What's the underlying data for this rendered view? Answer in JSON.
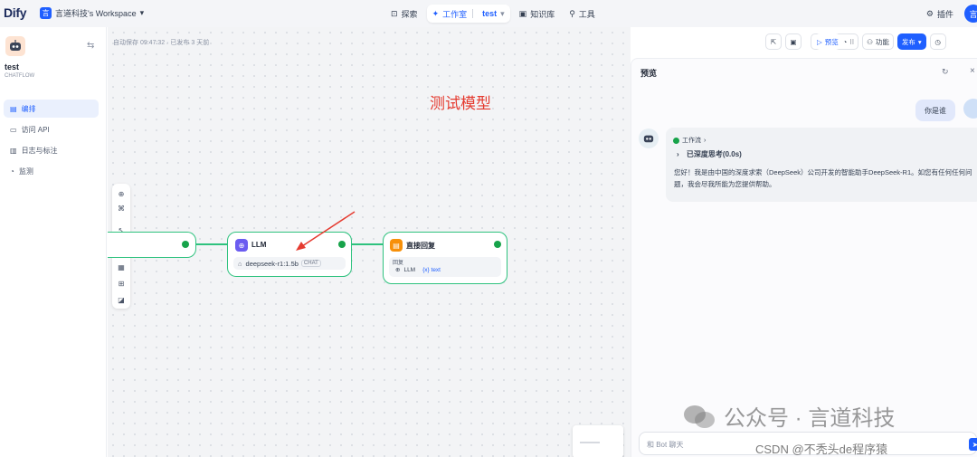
{
  "topbar": {
    "logo": "Dify",
    "workspace_badge": "言",
    "workspace": "言道科技's Workspace",
    "nav": {
      "explore": "探索",
      "studio": "工作室",
      "studio_app": "test",
      "knowledge": "知识库",
      "tools": "工具"
    },
    "plugins": "插件",
    "user_initial": "言"
  },
  "sidebar": {
    "app_name": "test",
    "app_type": "CHATFLOW",
    "items": [
      {
        "label": "编排",
        "icon": "orchestrate-icon",
        "active": true
      },
      {
        "label": "访问 API",
        "icon": "api-icon",
        "active": false
      },
      {
        "label": "日志与标注",
        "icon": "logs-icon",
        "active": false
      },
      {
        "label": "监测",
        "icon": "monitor-icon",
        "active": false
      }
    ]
  },
  "canvas": {
    "autosave": "自动保存 09:47:32 · 已发布 3 天前",
    "annotation": "测试模型",
    "llm_node": {
      "title": "LLM",
      "model": "deepseek-r1:1.5b",
      "tag": "CHAT"
    },
    "answer_node": {
      "title": "直接回复",
      "field_label": "回复",
      "source": "LLM",
      "var": "{x} text"
    }
  },
  "header_tools": {
    "preview": "预览",
    "features": "功能",
    "publish": "发布"
  },
  "preview": {
    "title": "预览",
    "user_message": "你是谁",
    "workflow_label": "工作流",
    "thinking": "已深度思考(0.0s)",
    "answer": "您好！我是由中国的深度求索（DeepSeek）公司开发的智能助手DeepSeek-R1。如您有任何任何问题，我会尽我所能为您提供帮助。",
    "input_placeholder": "和 Bot 聊天",
    "watermark": "公众号 · 言道科技",
    "csdn_watermark": "CSDN @不秃头de程序猿"
  },
  "colors": {
    "accent": "#1f5fff",
    "success": "#2ec27e",
    "annotation": "#e53b30"
  }
}
